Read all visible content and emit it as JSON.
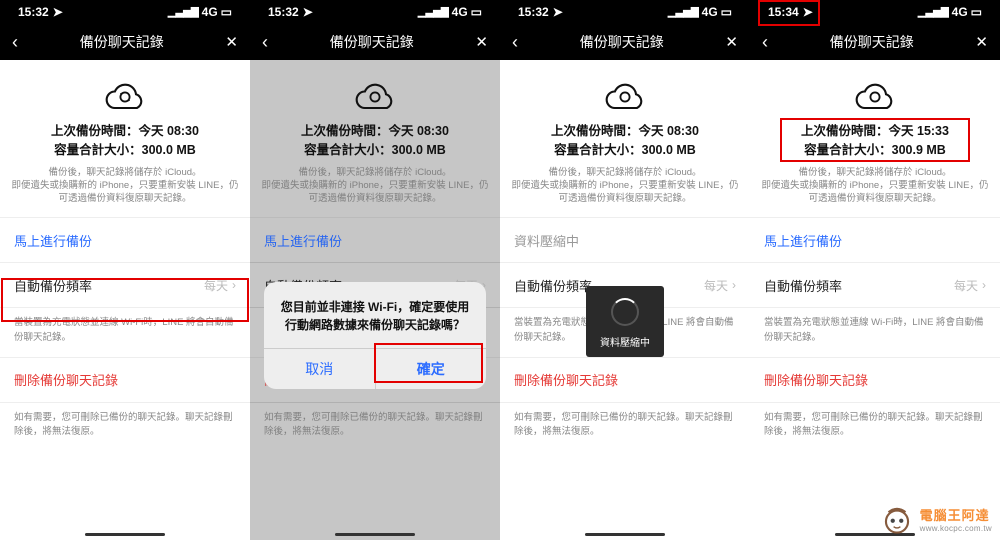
{
  "statusbar": {
    "time_a": "15:32",
    "time_b": "15:34",
    "net": "4G",
    "loc": "✈",
    "sig": "▮▮▮▮",
    "bat": "■■"
  },
  "header": {
    "back": "‹",
    "title": "備份聊天記錄",
    "close": "✕"
  },
  "info": {
    "line1": "上次備份時間：今天 08:30",
    "line2": "容量合計大小：300.0 MB",
    "line1_d": "上次備份時間：今天 15:33",
    "line2_d": "容量合計大小：300.9 MB",
    "caption": "備份後，聊天記錄將儲存於 iCloud。\n即便遺失或換購新的 iPhone，只要重新安裝 LINE，仍可透過備份資料復原聊天記錄。"
  },
  "items": {
    "backup_now": "馬上進行備份",
    "freq_label": "自動備份頻率",
    "freq_value": "每天",
    "delete_backup": "刪除備份聊天記錄",
    "compress_label": "資料壓縮中"
  },
  "notes": {
    "auto": "當裝置為充電狀態並連線 Wi-Fi時，LINE 將會自動備份聊天記錄。",
    "delete": "如有需要，您可刪除已備份的聊天記錄。聊天記錄刪除後，將無法復原。"
  },
  "alert": {
    "msg": "您目前並非連接 Wi-Fi，確定要使用行動網路數據來備份聊天記錄嗎？",
    "cancel": "取消",
    "ok": "確定"
  },
  "loader": {
    "text": "資料壓縮中"
  },
  "watermark": {
    "ch": "電腦王阿達",
    "en": "www.kocpc.com.tw"
  }
}
